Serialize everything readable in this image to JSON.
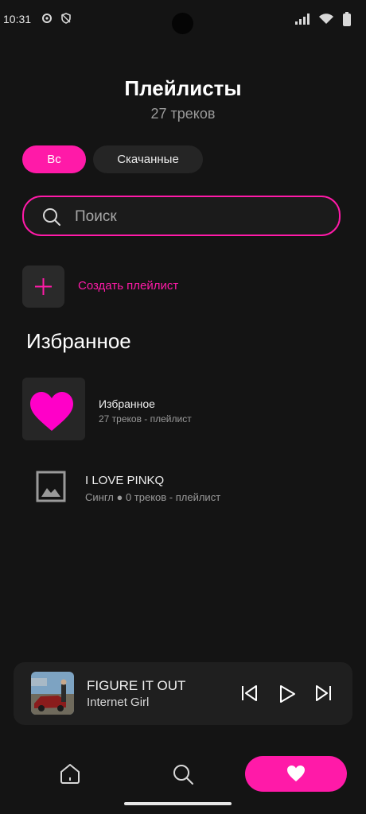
{
  "status": {
    "time": "10:31"
  },
  "header": {
    "title": "Плейлисты",
    "subtitle": "27 треков"
  },
  "filters": {
    "all": "Вс",
    "downloaded": "Скачанные"
  },
  "search": {
    "placeholder": "Поиск"
  },
  "create": {
    "label": "Создать плейлист"
  },
  "section": {
    "title": "Избранное"
  },
  "playlists": [
    {
      "name": "Избранное",
      "meta": "27 треков - плейлист"
    },
    {
      "name": "I LOVE PINKQ",
      "meta": "Сингл ● 0 треков - плейлист"
    }
  ],
  "now_playing": {
    "title": "FIGURE IT OUT",
    "artist": "Internet Girl"
  },
  "colors": {
    "accent": "#ff1aa8",
    "background": "#141414"
  }
}
